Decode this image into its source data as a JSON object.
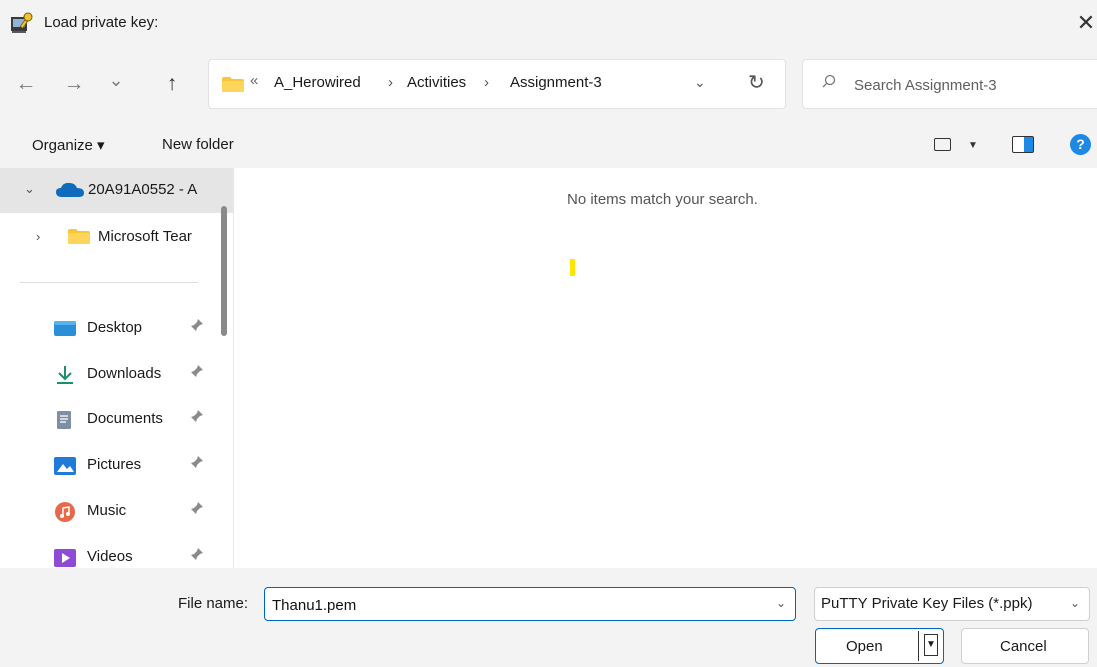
{
  "window": {
    "title": "Load private key:",
    "close_glyph": "✕",
    "app_icon": "putty-key-icon"
  },
  "nav": {
    "back_glyph": "←",
    "forward_glyph": "→",
    "recent_glyph": "⌄",
    "up_glyph": "↑"
  },
  "address": {
    "overflow_glyph": "«",
    "crumbs": [
      "A_Herowired",
      "Activities",
      "Assignment-3"
    ],
    "separator": "›",
    "dropdown_glyph": "⌄",
    "refresh_glyph": "↻"
  },
  "search": {
    "placeholder": "Search Assignment-3",
    "icon_glyph": "⚲"
  },
  "toolbar": {
    "organize_label": "Organize ▾",
    "new_folder_label": "New folder",
    "view_caret": "▼",
    "help_glyph": "?"
  },
  "sidebar": {
    "onedrive": {
      "label": "20A91A0552 - A",
      "chevron": "⌄"
    },
    "teams": {
      "label": "Microsoft Tear",
      "chevron": "›"
    },
    "quick_access": [
      {
        "label": "Desktop",
        "icon": "desktop-icon"
      },
      {
        "label": "Downloads",
        "icon": "downloads-icon"
      },
      {
        "label": "Documents",
        "icon": "documents-icon"
      },
      {
        "label": "Pictures",
        "icon": "pictures-icon"
      },
      {
        "label": "Music",
        "icon": "music-icon"
      },
      {
        "label": "Videos",
        "icon": "videos-icon"
      }
    ],
    "pin_glyph": "📌"
  },
  "content": {
    "empty_message": "No items match your search."
  },
  "bottom": {
    "filename_label": "File name:",
    "filename_value": "Thanu1.pem",
    "dropdown_glyph": "⌄",
    "filetype_label": "PuTTY Private Key Files (*.ppk)",
    "open_label": "Open",
    "open_caret": "▼",
    "cancel_label": "Cancel"
  },
  "colors": {
    "accent": "#0067c0",
    "chrome_bg": "#f3f3f3",
    "folder_yellow": "#f8c63a",
    "onedrive_blue": "#0f6cbd",
    "selection_bg": "#e5e5e5"
  }
}
